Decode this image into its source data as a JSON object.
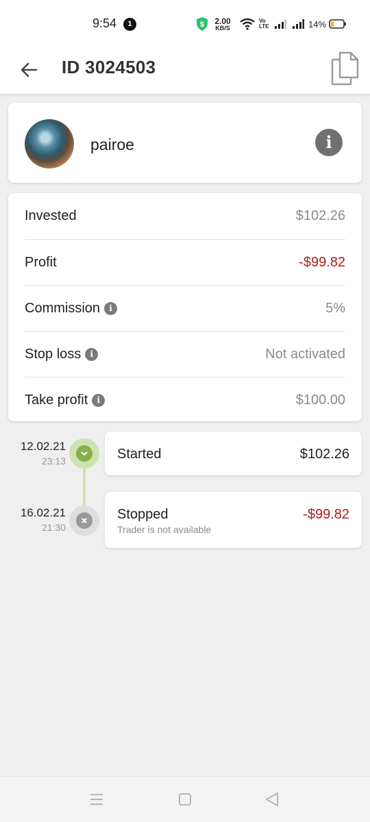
{
  "status_bar": {
    "time": "9:54",
    "notification_count": "1",
    "net_speed_value": "2.00",
    "net_speed_unit": "KB/S",
    "volte_top": "Vo",
    "volte_bottom": "LTE",
    "battery_percent": "14%"
  },
  "header": {
    "title": "ID 3024503",
    "back_icon": "arrow-left-icon",
    "copy_icon": "copy-icon"
  },
  "trader": {
    "name": "pairoe",
    "info_glyph": "i"
  },
  "details": [
    {
      "label": "Invested",
      "value": "$102.26",
      "has_hint": false,
      "negative": false
    },
    {
      "label": "Profit",
      "value": "-$99.82",
      "has_hint": false,
      "negative": true
    },
    {
      "label": "Commission",
      "value": "5%",
      "has_hint": true,
      "negative": false
    },
    {
      "label": "Stop loss",
      "value": "Not activated",
      "has_hint": true,
      "negative": false
    },
    {
      "label": "Take profit",
      "value": "$100.00",
      "has_hint": true,
      "negative": false
    }
  ],
  "timeline": [
    {
      "date": "12.02.21",
      "time": "23:13",
      "title": "Started",
      "subtitle": "",
      "amount": "$102.26",
      "status": "active"
    },
    {
      "date": "16.02.21",
      "time": "21:30",
      "title": "Stopped",
      "subtitle": "Trader is not available",
      "amount": "-$99.82",
      "status": "stopped"
    }
  ],
  "colors": {
    "negative": "#b11a1a",
    "accent_green": "#86b04a",
    "accent_green_light": "#cfe3b2",
    "muted_text": "#8a8a8a",
    "background": "#efefef"
  },
  "nav": {
    "recents_icon": "menu-lines-icon",
    "home_icon": "square-icon",
    "back_icon": "triangle-back-icon"
  }
}
